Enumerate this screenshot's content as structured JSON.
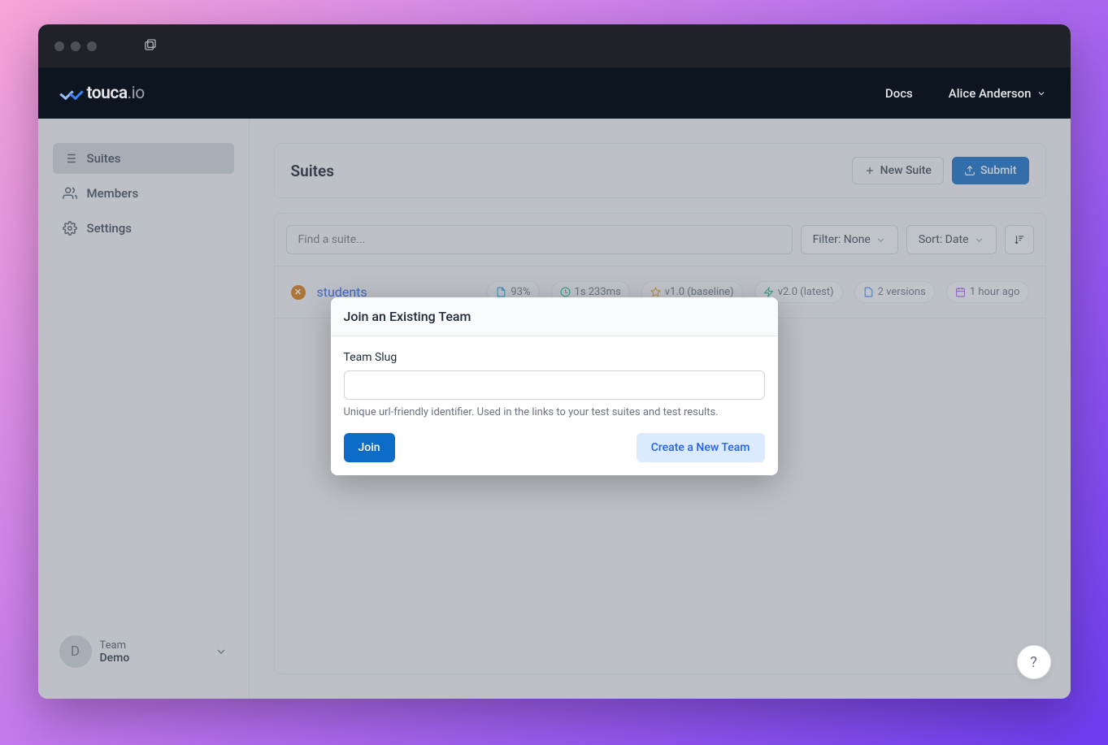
{
  "brand": {
    "name": "touca",
    "tld": ".io"
  },
  "header": {
    "docs_label": "Docs",
    "user_name": "Alice Anderson"
  },
  "sidebar": {
    "items": [
      {
        "label": "Suites"
      },
      {
        "label": "Members"
      },
      {
        "label": "Settings"
      }
    ],
    "team": {
      "label": "Team",
      "name": "Demo",
      "initial": "D"
    }
  },
  "page": {
    "title": "Suites",
    "new_suite_label": "New Suite",
    "submit_label": "Submit",
    "search_placeholder": "Find a suite...",
    "filter_label": "Filter: None",
    "sort_label": "Sort: Date"
  },
  "suite": {
    "name": "students",
    "match": "93%",
    "duration": "1s 233ms",
    "baseline": "v1.0 (baseline)",
    "latest": "v2.0 (latest)",
    "versions": "2 versions",
    "age": "1 hour ago"
  },
  "modal": {
    "title": "Join an Existing Team",
    "field_label": "Team Slug",
    "help_text": "Unique url-friendly identifier. Used in the links to your test suites and test results.",
    "join_label": "Join",
    "create_label": "Create a New Team"
  },
  "help_fab": "?"
}
